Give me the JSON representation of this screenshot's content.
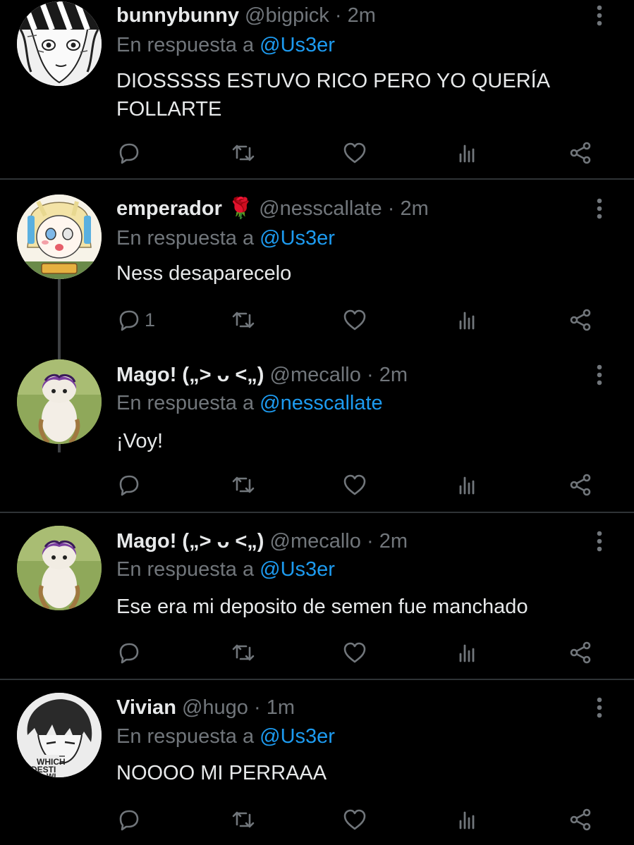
{
  "tweets": [
    {
      "name": "bunnybunny",
      "emoji": "",
      "handle": "@bigpick",
      "dot": "·",
      "time": "2m",
      "reply_prefix": "En respuesta a ",
      "reply_to": "@Us3er",
      "line1": "DIOSSSSS ESTUVO RICO PERO YO QUERÍA",
      "line2": "FOLLARTE",
      "reply_count": "",
      "avatar": "manga-boy-bw"
    },
    {
      "name": "emperador",
      "emoji": "🌹",
      "handle": "@nesscallate",
      "dot": "·",
      "time": "2m",
      "reply_prefix": "En respuesta a ",
      "reply_to": "@Us3er",
      "line1": "Ness desaparecelo",
      "line2": "",
      "reply_count": "1",
      "avatar": "anime-blonde-character"
    },
    {
      "name": "Mago!  („> ᴗ <„)",
      "emoji": "",
      "handle": "@mecallo",
      "dot": "·",
      "time": "2m",
      "reply_prefix": "En respuesta a ",
      "reply_to": "@nesscallate",
      "line1": "¡Voy!",
      "line2": "",
      "reply_count": "",
      "avatar": "cat-purple-hair"
    },
    {
      "name": "Mago!  („> ᴗ <„)",
      "emoji": "",
      "handle": "@mecallo",
      "dot": "·",
      "time": "2m",
      "reply_prefix": "En respuesta a ",
      "reply_to": "@Us3er",
      "line1": "Ese era mi deposito de semen fue manchado",
      "line2": "",
      "reply_count": "",
      "avatar": "cat-purple-hair"
    },
    {
      "name": "Vivian",
      "emoji": "",
      "handle": "@hugo",
      "dot": "·",
      "time": "1m",
      "reply_prefix": "En respuesta a ",
      "reply_to": "@Us3er",
      "line1": "NOOOO MI PERRAAA",
      "line2": "",
      "reply_count": "",
      "avatar": "manga-boy-which-destiny",
      "avatar_text": [
        "WHICH",
        "DESTI",
        "WI"
      ]
    }
  ],
  "icons": {
    "reply": "reply-icon",
    "retweet": "retweet-icon",
    "like": "like-icon",
    "views": "views-icon",
    "share": "share-icon",
    "more": "more-icon"
  },
  "colors": {
    "background": "#000000",
    "text": "#e7e9ea",
    "secondary": "#71767b",
    "accent": "#1d9bf0",
    "divider": "#2f3336"
  }
}
